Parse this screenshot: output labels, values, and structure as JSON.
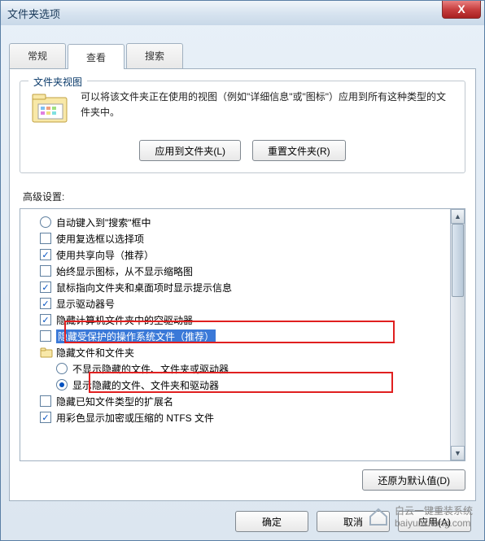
{
  "title": "文件夹选项",
  "tabs": {
    "general": "常规",
    "view": "查看",
    "search": "搜索"
  },
  "group": {
    "title": "文件夹视图",
    "desc": "可以将该文件夹正在使用的视图（例如\"详细信息\"或\"图标\"）应用到所有这种类型的文件夹中。",
    "apply": "应用到文件夹(L)",
    "reset": "重置文件夹(R)"
  },
  "adv_label": "高级设置:",
  "items": [
    {
      "type": "radio",
      "checked": false,
      "indent": 1,
      "text": "自动键入到\"搜索\"框中"
    },
    {
      "type": "check",
      "checked": false,
      "indent": 1,
      "text": "使用复选框以选择项"
    },
    {
      "type": "check",
      "checked": true,
      "indent": 1,
      "text": "使用共享向导（推荐）"
    },
    {
      "type": "check",
      "checked": false,
      "indent": 1,
      "text": "始终显示图标，从不显示缩略图"
    },
    {
      "type": "check",
      "checked": true,
      "indent": 1,
      "text": "鼠标指向文件夹和桌面项时显示提示信息"
    },
    {
      "type": "check",
      "checked": true,
      "indent": 1,
      "text": "显示驱动器号"
    },
    {
      "type": "check",
      "checked": true,
      "indent": 1,
      "text": "隐藏计算机文件夹中的空驱动器"
    },
    {
      "type": "check",
      "checked": false,
      "indent": 1,
      "text": "隐藏受保护的操作系统文件（推荐）",
      "highlight": true
    },
    {
      "type": "folder",
      "indent": 1,
      "text": "隐藏文件和文件夹"
    },
    {
      "type": "radio",
      "checked": false,
      "indent": 2,
      "text": "不显示隐藏的文件、文件夹或驱动器"
    },
    {
      "type": "radio",
      "checked": true,
      "indent": 2,
      "text": "显示隐藏的文件、文件夹和驱动器"
    },
    {
      "type": "check",
      "checked": false,
      "indent": 1,
      "text": "隐藏已知文件类型的扩展名"
    },
    {
      "type": "check",
      "checked": true,
      "indent": 1,
      "text": "用彩色显示加密或压缩的 NTFS 文件"
    }
  ],
  "restore": "还原为默认值(D)",
  "ok": "确定",
  "cancel": "取消",
  "apply_btn": "应用(A)",
  "watermark": {
    "line1": "白云一键重装系统",
    "line2": "baiyunxitong.com"
  }
}
